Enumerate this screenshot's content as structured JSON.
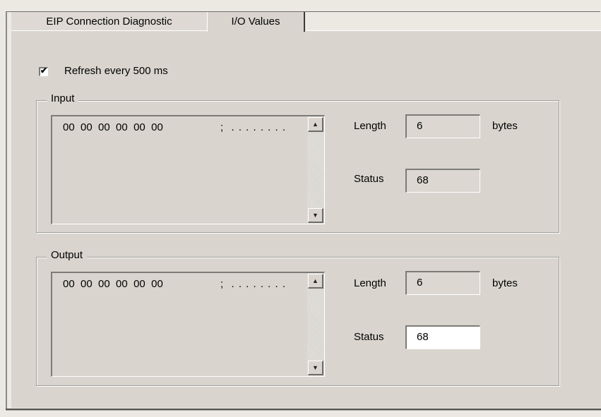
{
  "tabs": [
    {
      "label": "EIP Connection Diagnostic",
      "active": false
    },
    {
      "label": "I/O Values",
      "active": true
    }
  ],
  "refresh": {
    "label": "Refresh every 500 ms",
    "checked": true,
    "checkmark": "✔"
  },
  "input": {
    "title": "Input",
    "data_row": "00  00  00  00  00  00",
    "ascii_row": ";  . . . . . . . .",
    "length_label": "Length",
    "length_value": "6",
    "length_unit": "bytes",
    "status_label": "Status",
    "status_value": "68"
  },
  "output": {
    "title": "Output",
    "data_row": "00  00  00  00  00  00",
    "ascii_row": ";  . . . . . . . .",
    "length_label": "Length",
    "length_value": "6",
    "length_unit": "bytes",
    "status_label": "Status",
    "status_value": "68"
  },
  "icons": {
    "scroll_up": "▲",
    "scroll_down": "▼"
  }
}
